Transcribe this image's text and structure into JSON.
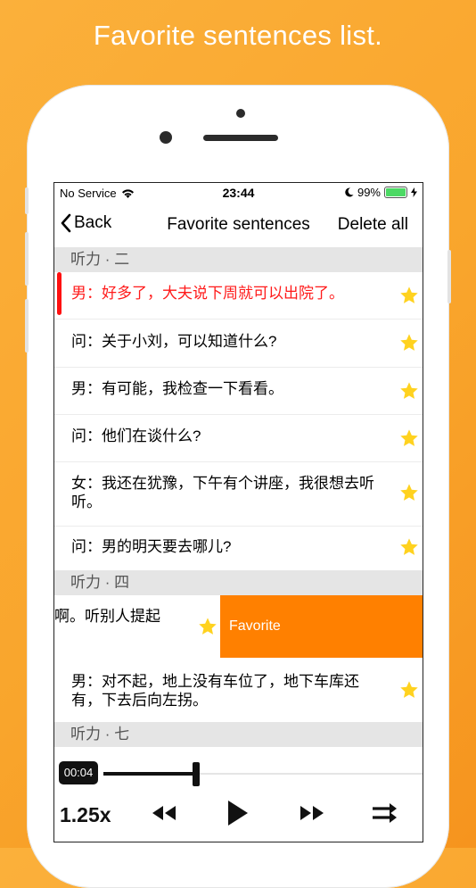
{
  "caption": "Favorite sentences list.",
  "status": {
    "carrier": "No Service",
    "time": "23:44",
    "battery": "99%"
  },
  "nav": {
    "back": "Back",
    "title": "Favorite sentences",
    "delete_all": "Delete all"
  },
  "sections": [
    {
      "title": "听力 · 二"
    },
    {
      "title": "听力 · 四"
    },
    {
      "title": "听力 · 七"
    }
  ],
  "rows": [
    {
      "text": "男：好多了，大夫说下周就可以出院了。",
      "highlighted": true
    },
    {
      "text": "问：关于小刘，可以知道什么?"
    },
    {
      "text": "男：有可能，我检查一下看看。"
    },
    {
      "text": "问：他们在谈什么?"
    },
    {
      "text": "女：我还在犹豫，下午有个讲座，我很想去听听。"
    },
    {
      "text": "问：男的明天要去哪儿?"
    },
    {
      "text": "啊。听别人提起"
    },
    {
      "text": "男：对不起，地上没有车位了，地下车库还有，下去后向左拐。"
    }
  ],
  "swipe_action": "Favorite",
  "player": {
    "current_time": "00:04",
    "progress": 0.29,
    "speed": "1.25x"
  },
  "icons": [
    "wifi-icon",
    "moon-icon",
    "battery-icon",
    "charging-icon",
    "chevron-left-icon",
    "star-icon",
    "rewind-icon",
    "play-icon",
    "fast-forward-icon",
    "shuffle-icon"
  ],
  "colors": {
    "background": "#f9a52c",
    "accent": "#ff8000",
    "highlight_text": "#ff1a1a",
    "star": "#ffd21f"
  }
}
